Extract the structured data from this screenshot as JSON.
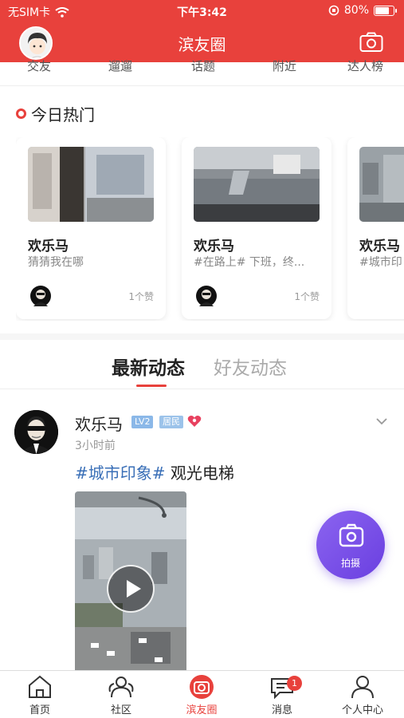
{
  "status": {
    "carrier": "无SIM卡",
    "time": "下午3:42",
    "battery": "80%",
    "battery_level": 0.8
  },
  "header": {
    "title": "滨友圈"
  },
  "top_tabs": [
    "交友",
    "遛遛",
    "话题",
    "附近",
    "达人榜"
  ],
  "hot": {
    "title": "今日热门",
    "cards": [
      {
        "name": "欢乐马",
        "desc": "猜猜我在哪",
        "likes": "1个赞"
      },
      {
        "name": "欢乐马",
        "desc": "#在路上# 下班，终...",
        "likes": "1个赞"
      },
      {
        "name": "欢乐马",
        "desc": "#城市印",
        "likes": ""
      }
    ]
  },
  "feed_tabs": {
    "latest": "最新动态",
    "friends": "好友动态"
  },
  "post": {
    "author": "欢乐马",
    "level": "LV2",
    "role": "居民",
    "time": "3小时前",
    "hashtag": "#城市印象#",
    "text": " 观光电梯"
  },
  "fab": {
    "label": "拍摄"
  },
  "bottom_nav": {
    "home": "首页",
    "community": "社区",
    "circle": "滨友圈",
    "messages": "消息",
    "messages_badge": "1",
    "profile": "个人中心"
  },
  "colors": {
    "brand": "#e8413c",
    "fab": "#7b50e8",
    "hashtag": "#3a6fb7"
  }
}
